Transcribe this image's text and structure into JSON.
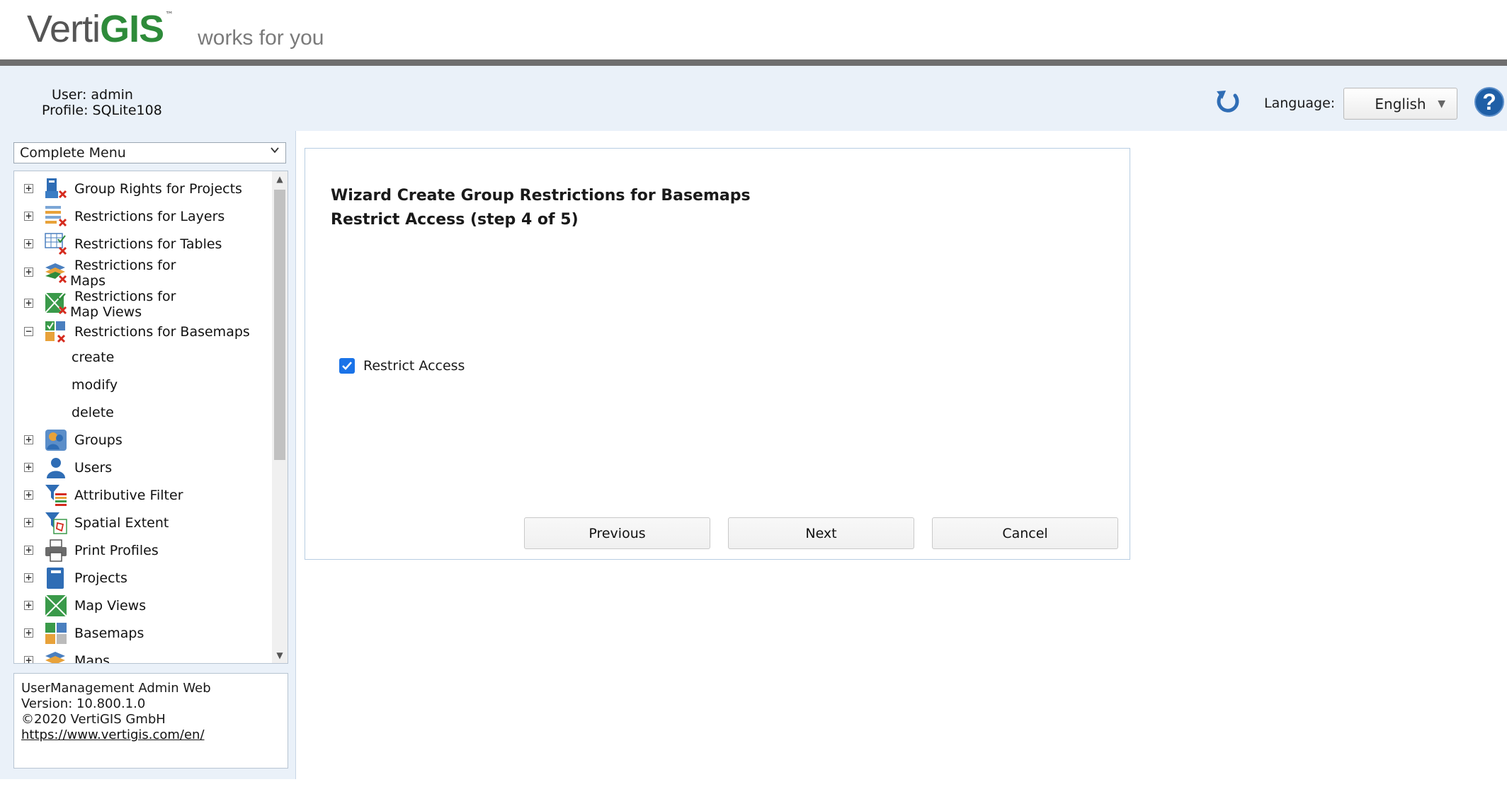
{
  "header": {
    "logo_part1": "Verti",
    "logo_part2": "GIS",
    "logo_tm": "™",
    "tagline": "works for you"
  },
  "userbar": {
    "user_label": "User: admin",
    "profile_label": "Profile: SQLite108",
    "language_label": "Language:",
    "language_value": "English",
    "help_glyph": "?"
  },
  "sidebar": {
    "menu_select_value": "Complete Menu",
    "tree": [
      {
        "label": "Group Rights for Projects",
        "icon": "group-rights-icon",
        "expanded": false
      },
      {
        "label": "Restrictions for Layers",
        "icon": "layer-restriction-icon",
        "expanded": false
      },
      {
        "label": "Restrictions for Tables",
        "icon": "table-restriction-icon",
        "expanded": false
      },
      {
        "label_line1": "Restrictions for",
        "label_line2": "Maps",
        "icon": "map-restriction-icon",
        "expanded": false
      },
      {
        "label_line1": "Restrictions for",
        "label_line2": "Map Views",
        "icon": "mapview-restriction-icon",
        "expanded": false
      },
      {
        "label": "Restrictions for Basemaps",
        "icon": "basemap-restriction-icon",
        "expanded": true
      },
      {
        "label": "Groups",
        "icon": "groups-icon",
        "expanded": false
      },
      {
        "label": "Users",
        "icon": "users-icon",
        "expanded": false
      },
      {
        "label": "Attributive Filter",
        "icon": "attributive-filter-icon",
        "expanded": false
      },
      {
        "label": "Spatial Extent",
        "icon": "spatial-extent-icon",
        "expanded": false
      },
      {
        "label": "Print Profiles",
        "icon": "printer-icon",
        "expanded": false
      },
      {
        "label": "Projects",
        "icon": "projects-icon",
        "expanded": false
      },
      {
        "label": "Map Views",
        "icon": "map-views-icon",
        "expanded": false
      },
      {
        "label": "Basemaps",
        "icon": "basemaps-icon",
        "expanded": false
      },
      {
        "label": "Maps",
        "icon": "maps-icon",
        "expanded": false
      }
    ],
    "basemap_children": [
      "create",
      "modify",
      "delete"
    ],
    "expand_glyph": "+",
    "collapse_glyph": "−"
  },
  "footer": {
    "app_name": "UserManagement Admin Web",
    "version": "Version: 10.800.1.0",
    "copyright": "©2020 VertiGIS GmbH",
    "link": "https://www.vertigis.com/en/"
  },
  "wizard": {
    "title_line1": "Wizard Create Group Restrictions for Basemaps",
    "title_line2": "Restrict Access (step 4 of 5)",
    "checkbox_label": "Restrict Access",
    "checkbox_checked": true,
    "previous_label": "Previous",
    "next_label": "Next",
    "cancel_label": "Cancel"
  },
  "colors": {
    "brand_green": "#2e8b3a",
    "panel_blue": "#eaf1f9",
    "accent_blue": "#1f5fa6",
    "checkbox_blue": "#1a73e8"
  }
}
